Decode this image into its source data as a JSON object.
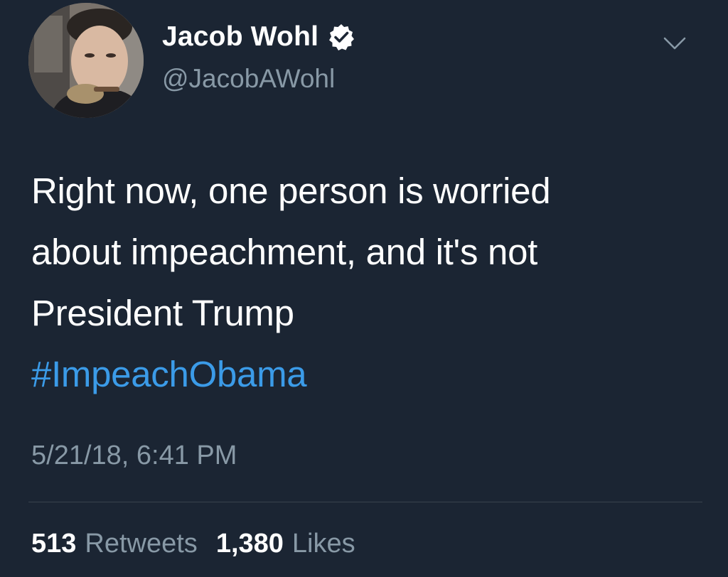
{
  "author": {
    "display_name": "Jacob Wohl",
    "handle": "@JacobAWohl",
    "verified": true
  },
  "tweet": {
    "lines": [
      "Right now, one person is worried",
      "about impeachment, and it's not",
      "President Trump"
    ],
    "hashtag": "#ImpeachObama",
    "timestamp": "5/21/18, 6:41 PM"
  },
  "stats": {
    "retweets_count": "513",
    "retweets_label": "Retweets",
    "likes_count": "1,380",
    "likes_label": "Likes"
  },
  "colors": {
    "background": "#1b2533",
    "text": "#ffffff",
    "secondary": "#8899a6",
    "link": "#3b9be8"
  },
  "icons": {
    "menu": "chevron-down-icon",
    "verified": "verified-badge-icon"
  }
}
